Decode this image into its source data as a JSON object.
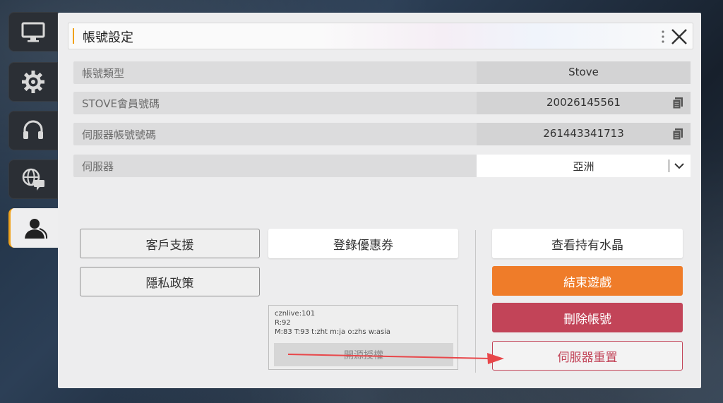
{
  "sidebar": {
    "items": [
      {
        "icon": "monitor-icon",
        "active": false
      },
      {
        "icon": "gear-icon",
        "active": false
      },
      {
        "icon": "headset-icon",
        "active": false
      },
      {
        "icon": "globe-chat-icon",
        "active": false
      },
      {
        "icon": "user-account-icon",
        "active": true
      }
    ]
  },
  "panel": {
    "title": "帳號設定",
    "accent_color": "#f0a21b"
  },
  "rows": {
    "account_type": {
      "label": "帳號類型",
      "value": "Stove"
    },
    "stove_id": {
      "label": "STOVE會員號碼",
      "value": "20026145561"
    },
    "server_id": {
      "label": "伺服器帳號號碼",
      "value": "261443341713"
    },
    "server": {
      "label": "伺服器",
      "value": "亞洲"
    }
  },
  "buttons": {
    "customer_support": "客戶支援",
    "coupon": "登錄優惠券",
    "view_crystals": "查看持有水晶",
    "privacy": "隱私政策",
    "end_game": "結束遊戲",
    "delete_account": "刪除帳號",
    "server_reset": "伺服器重置"
  },
  "info": {
    "line1": "cznlive:101",
    "line2": "R:92",
    "line3": "M:83 T:93 t:zht m:ja o:zhs w:asia",
    "oss_label": "開源授權"
  },
  "colors": {
    "orange": "#ef7c29",
    "red": "#c24458",
    "arrow": "#e8474a"
  }
}
